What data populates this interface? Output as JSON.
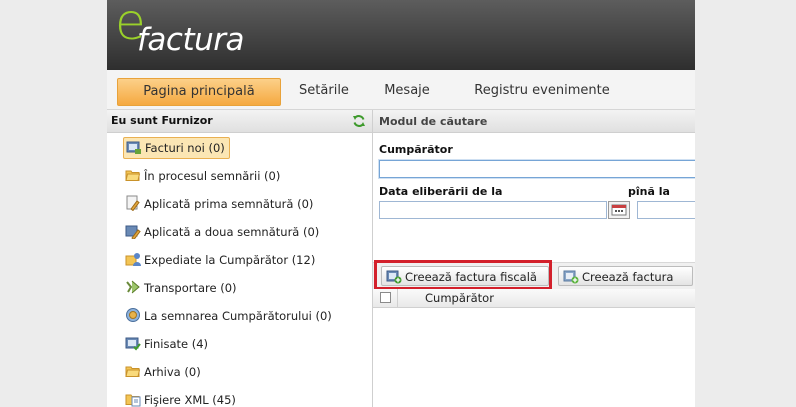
{
  "logo": {
    "prefix": "e",
    "word": "factura"
  },
  "nav": {
    "tabs": [
      {
        "label": "Pagina principală",
        "active": true
      },
      {
        "label": "Setările",
        "active": false
      },
      {
        "label": "Mesaje",
        "active": false
      },
      {
        "label": "Registru evenimente",
        "active": false
      }
    ]
  },
  "left_panel": {
    "title": "Eu sunt Furnizor",
    "refresh_icon": "refresh-icon",
    "items": [
      {
        "label": "Facturi noi (0)",
        "icon": "invoice-icon",
        "selected": true
      },
      {
        "label": "În procesul semnării (0)",
        "icon": "folder-open-icon",
        "selected": false
      },
      {
        "label": "Aplicată prima semnătură (0)",
        "icon": "sign-document-icon",
        "selected": false
      },
      {
        "label": "Aplicată a doua semnătură (0)",
        "icon": "sign-document-2-icon",
        "selected": false
      },
      {
        "label": "Expediate la Cumpărător (12)",
        "icon": "send-to-user-icon",
        "selected": false
      },
      {
        "label": "Transportare (0)",
        "icon": "transport-icon",
        "selected": false
      },
      {
        "label": "La semnarea Cumpărătorului (0)",
        "icon": "shield-sign-icon",
        "selected": false
      },
      {
        "label": "Finisate (4)",
        "icon": "finished-icon",
        "selected": false
      },
      {
        "label": "Arhiva (0)",
        "icon": "archive-folder-icon",
        "selected": false
      },
      {
        "label": "Fişiere XML (45)",
        "icon": "xml-file-icon",
        "selected": false
      }
    ]
  },
  "search": {
    "title": "Modul de căutare",
    "buyer_label": "Cumpărător",
    "buyer_value": "",
    "date_from_label": "Data eliberării de la",
    "date_to_label": "pînă la",
    "date_from_value": "",
    "date_to_value": ""
  },
  "toolbar": {
    "create_fiscal": "Creează factura fiscală",
    "create_invoice": "Creează factura"
  },
  "grid": {
    "columns": [
      "Cumpărător"
    ]
  },
  "colors": {
    "accent_orange": "#f5a940",
    "logo_green": "#9ad12a",
    "highlight_red": "#d3202b"
  }
}
